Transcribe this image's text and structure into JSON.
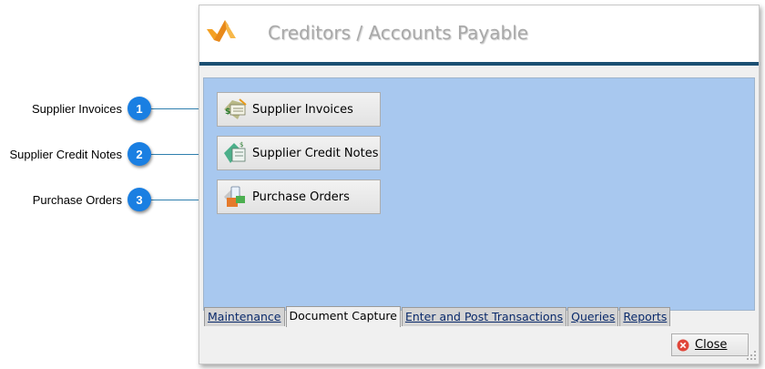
{
  "callouts": [
    {
      "number": "1",
      "label": "Supplier Invoices"
    },
    {
      "number": "2",
      "label": "Supplier Credit Notes"
    },
    {
      "number": "3",
      "label": "Purchase Orders"
    }
  ],
  "window": {
    "title": "Creditors / Accounts Payable",
    "logo_icon": "company-logo-icon"
  },
  "actions": [
    {
      "label": "Supplier Invoices",
      "icon": "invoice-icon"
    },
    {
      "label": "Supplier Credit Notes",
      "icon": "credit-note-icon"
    },
    {
      "label": "Purchase Orders",
      "icon": "purchase-order-icon"
    }
  ],
  "tabs": [
    {
      "label": "Maintenance",
      "active": false
    },
    {
      "label": "Document Capture",
      "active": true
    },
    {
      "label": "Enter and Post Transactions",
      "active": false
    },
    {
      "label": "Queries",
      "active": false
    },
    {
      "label": "Reports",
      "active": false
    }
  ],
  "close_button": {
    "label": "Close",
    "icon": "close-circle-icon"
  },
  "colors": {
    "accent_bar": "#1b4f72",
    "content_bg": "#a8c8ef",
    "badge": "#1a7fe2"
  }
}
